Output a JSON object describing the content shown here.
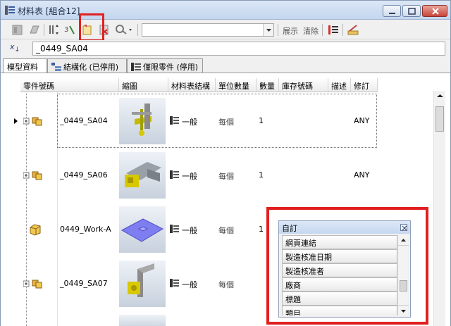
{
  "window": {
    "title": "材料表 [組合12]"
  },
  "toolbar": {
    "combo_value": "",
    "expand_label": "展示",
    "clear_label": "清除"
  },
  "part": {
    "name_value": "_0449_SA04"
  },
  "tabs": [
    {
      "label": "模型資料"
    },
    {
      "label": "結構化 (已停用)"
    },
    {
      "label": "僅限零件 (停用)"
    }
  ],
  "grid": {
    "headers": [
      "零件號碼",
      "縮圖",
      "材料表結構",
      "單位數量",
      "數量",
      "庫存號碼",
      "描述",
      "修訂"
    ],
    "rows": [
      {
        "part_number": "_0449_SA04",
        "structure": "一般",
        "unit": "每個",
        "qty": "1",
        "revision": "ANY"
      },
      {
        "part_number": "_0449_SA06",
        "structure": "一般",
        "unit": "每個",
        "qty": "1",
        "revision": "ANY"
      },
      {
        "part_number": "0449_Work-A",
        "structure": "一般",
        "unit": "每個",
        "qty": "1",
        "revision": ""
      },
      {
        "part_number": "_0449_SA07",
        "structure": "一般",
        "unit": "每個",
        "qty": "",
        "revision": ""
      }
    ]
  },
  "popup": {
    "title": "自訂",
    "items": [
      "網頁連結",
      "製造核准日期",
      "製造核准者",
      "廠商",
      "標題",
      "類目"
    ]
  },
  "colors": {
    "highlight": "#e02020",
    "selection_border": "#6f6f6f"
  }
}
